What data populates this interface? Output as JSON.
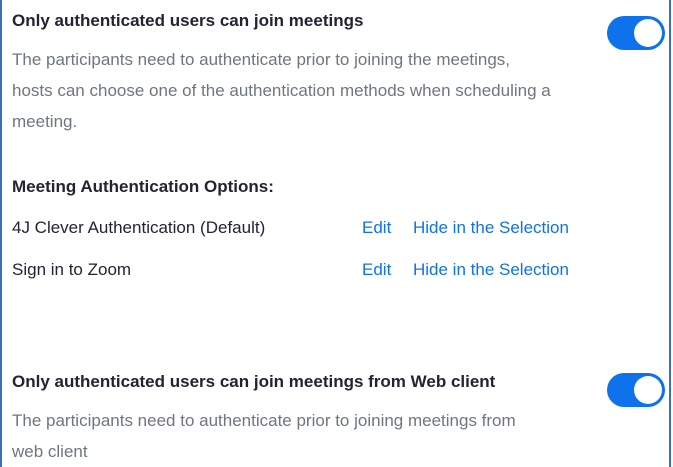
{
  "setting_join": {
    "title": "Only authenticated users can join meetings",
    "description": "The participants need to authenticate prior to joining the meetings, hosts can choose one of the authentication methods when scheduling a meeting.",
    "enabled": true
  },
  "auth_options": {
    "title": "Meeting Authentication Options:",
    "items": [
      {
        "name": "4J Clever Authentication (Default)",
        "edit_label": "Edit",
        "hide_label": "Hide in the Selection"
      },
      {
        "name": "Sign in to Zoom",
        "edit_label": "Edit",
        "hide_label": "Hide in the Selection"
      }
    ]
  },
  "setting_web": {
    "title": "Only authenticated users can join meetings from Web client",
    "description": "The participants need to authenticate prior to joining meetings from web client",
    "enabled": true
  },
  "colors": {
    "accent": "#0e72ed",
    "text": "#232333",
    "muted": "#6e7680",
    "border": "#3d6fb7"
  }
}
